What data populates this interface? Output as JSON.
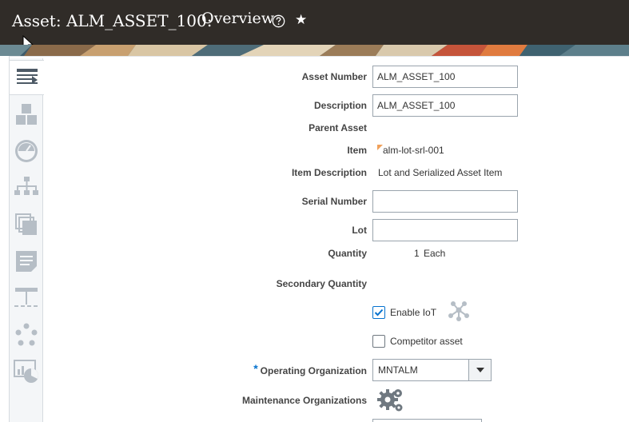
{
  "header": {
    "asset_title": "Asset: ALM_ASSET_100:",
    "page_title": "Overview",
    "help_icon": "help-circle-icon",
    "star_icon": "star-icon",
    "star_glyph": "★"
  },
  "sidebar": {
    "items": [
      {
        "name": "overview",
        "icon": "overview-icon",
        "active": true
      },
      {
        "name": "structure",
        "icon": "blocks-icon"
      },
      {
        "name": "meters",
        "icon": "gauge-icon"
      },
      {
        "name": "hierarchy",
        "icon": "hierarchy-icon"
      },
      {
        "name": "documents",
        "icon": "copy-icon"
      },
      {
        "name": "notes",
        "icon": "notes-icon"
      },
      {
        "name": "logical-hierarchy",
        "icon": "tree-icon"
      },
      {
        "name": "lifecycle",
        "icon": "cycle-icon"
      },
      {
        "name": "analytics",
        "icon": "analytics-icon"
      }
    ]
  },
  "form": {
    "asset_number": {
      "label": "Asset Number",
      "value": "ALM_ASSET_100"
    },
    "description": {
      "label": "Description",
      "value": "ALM_ASSET_100"
    },
    "parent_asset": {
      "label": "Parent Asset",
      "value": ""
    },
    "item": {
      "label": "Item",
      "value": "alm-lot-srl-001"
    },
    "item_description": {
      "label": "Item Description",
      "value": "Lot and Serialized Asset Item"
    },
    "serial_number": {
      "label": "Serial Number",
      "value": ""
    },
    "lot": {
      "label": "Lot",
      "value": ""
    },
    "quantity": {
      "label": "Quantity",
      "value": "1",
      "uom": "Each"
    },
    "secondary_quantity": {
      "label": "Secondary Quantity",
      "value": ""
    },
    "enable_iot": {
      "label": "Enable IoT",
      "checked": true,
      "icon": "iot-network-icon"
    },
    "competitor_asset": {
      "label": "Competitor asset",
      "checked": false
    },
    "operating_organization": {
      "label": "Operating Organization",
      "required_mark": "*",
      "value": "MNTALM"
    },
    "maintenance_organizations": {
      "label": "Maintenance Organizations",
      "icon": "gears-icon"
    }
  },
  "colors": {
    "header_bg": "#302c28",
    "accent": "#0572ce"
  }
}
